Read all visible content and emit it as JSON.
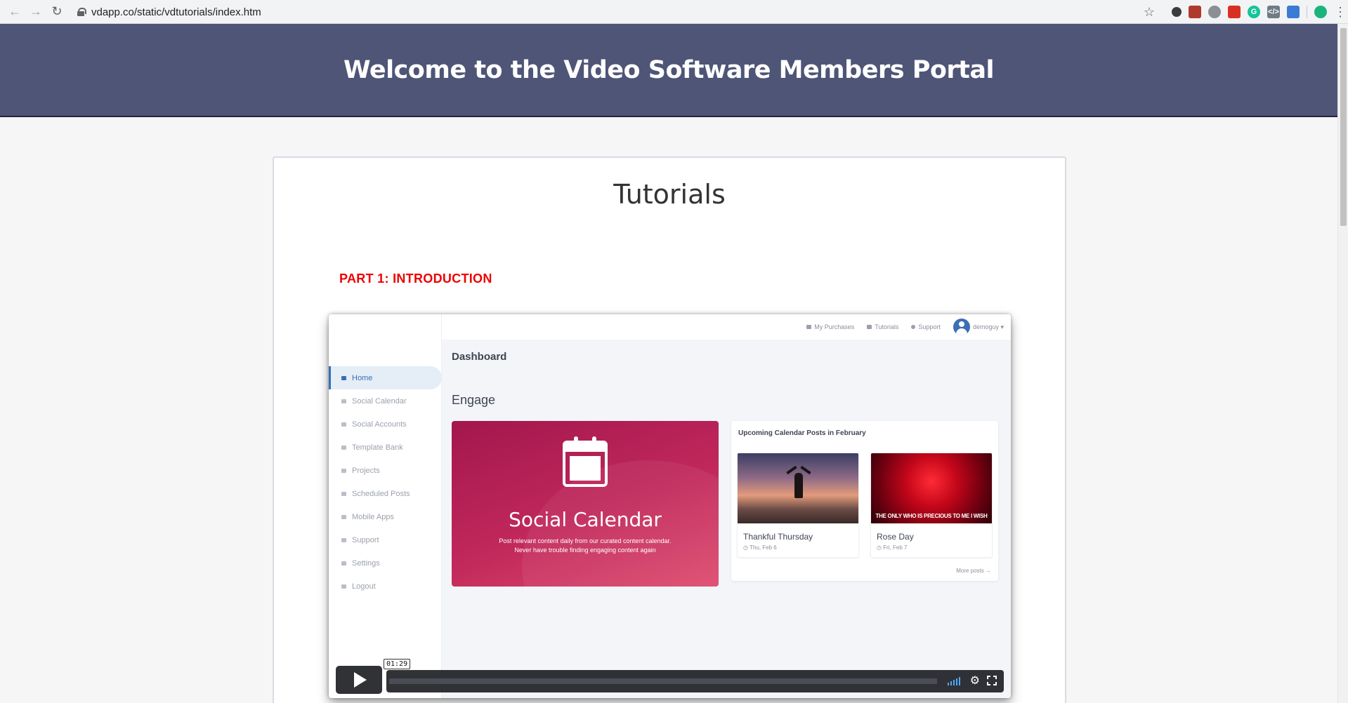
{
  "browser": {
    "url": "vdapp.co/static/vdtutorials/index.htm"
  },
  "banner": {
    "title": "Welcome to the Video Software Members Portal"
  },
  "page": {
    "title": "Tutorials",
    "part_title": "PART 1: INTRODUCTION"
  },
  "video": {
    "topbar": {
      "purchases": "My Purchases",
      "tutorials": "Tutorials",
      "support": "Support",
      "user": "demoguy ▾"
    },
    "sidebar": {
      "items": [
        {
          "label": "Home"
        },
        {
          "label": "Social Calendar"
        },
        {
          "label": "Social Accounts"
        },
        {
          "label": "Template Bank"
        },
        {
          "label": "Projects"
        },
        {
          "label": "Scheduled Posts"
        },
        {
          "label": "Mobile Apps"
        },
        {
          "label": "Support"
        },
        {
          "label": "Settings"
        },
        {
          "label": "Logout"
        }
      ]
    },
    "dashboard_title": "Dashboard",
    "section_title": "Engage",
    "social_calendar": {
      "title": "Social Calendar",
      "line1": "Post relevant content daily from our curated content calendar.",
      "line2": "Never have trouble finding engaging content again"
    },
    "upcoming": {
      "title": "Upcoming Calendar Posts in February",
      "posts": [
        {
          "name": "Thankful Thursday",
          "date": "Thu, Feb 6"
        },
        {
          "name": "Rose Day",
          "date": "Fri, Feb 7",
          "caption": "THE ONLY WHO IS PRECIOUS TO ME I WISH"
        }
      ],
      "more": "More posts →"
    },
    "player": {
      "time": "01:29",
      "progress": 0,
      "accent": "#4da8ff"
    }
  }
}
